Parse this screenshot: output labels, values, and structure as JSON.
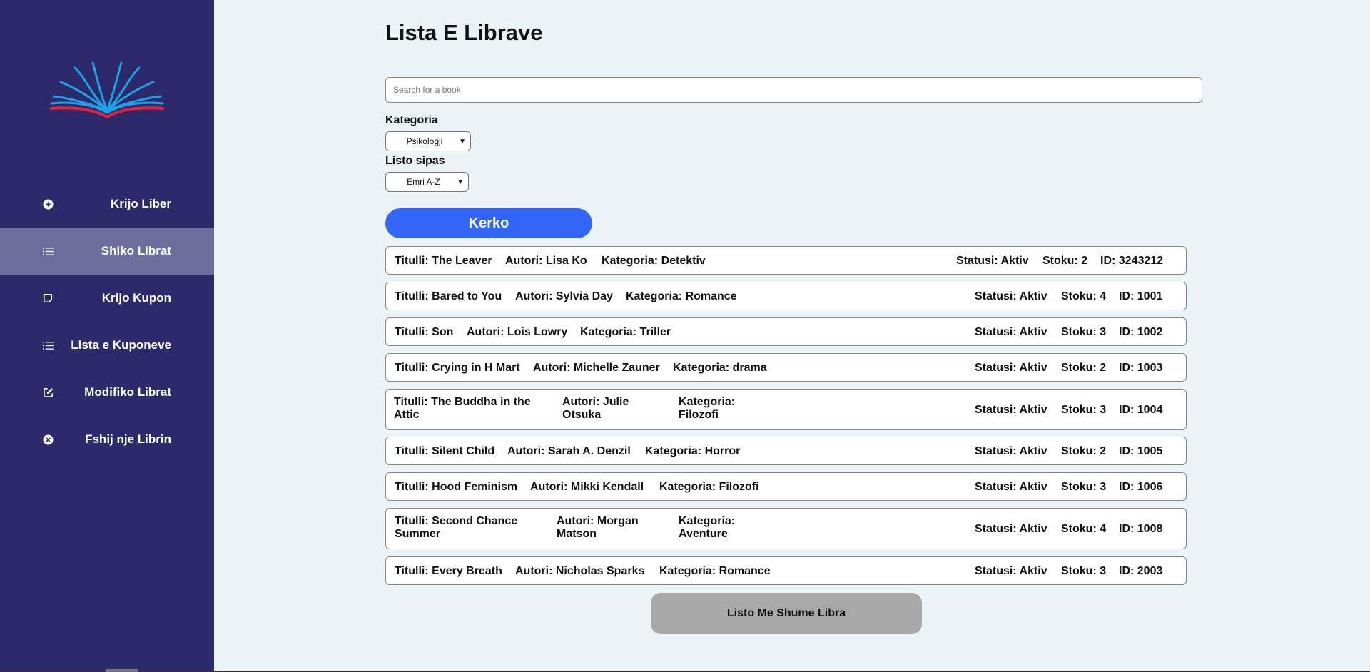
{
  "sidebar": {
    "items": [
      {
        "label": "Krijo Liber",
        "icon": "plus-circle-icon",
        "active": false
      },
      {
        "label": "Shiko Librat",
        "icon": "list-icon",
        "active": true
      },
      {
        "label": "Krijo Kupon",
        "icon": "note-icon",
        "active": false
      },
      {
        "label": "Lista e Kuponeve",
        "icon": "list-icon",
        "active": false
      },
      {
        "label": "Modifiko Librat",
        "icon": "edit-icon",
        "active": false
      },
      {
        "label": "Fshij nje Librin",
        "icon": "close-circle-icon",
        "active": false
      }
    ]
  },
  "main": {
    "title": "Lista E Librave",
    "search_placeholder": "Search for a book",
    "category_label": "Kategoria",
    "category_value": "Psikologji",
    "sort_label": "Listo sipas",
    "sort_value": "Emri A-Z",
    "search_button": "Kerko",
    "more_button": "Listo Me Shume Libra"
  },
  "books": [
    {
      "title": "Titulli: The Leaver",
      "author": "Autori: Lisa Ko",
      "category": "Kategoria: Detektiv",
      "status": "Statusi: Aktiv",
      "stock": "Stoku: 2",
      "id": "ID: 3243212"
    },
    {
      "title": "Titulli: Bared to You",
      "author": "Autori: Sylvia Day",
      "category": "Kategoria: Romance",
      "status": "Statusi: Aktiv",
      "stock": "Stoku: 4",
      "id": "ID: 1001"
    },
    {
      "title": "Titulli: Son",
      "author": "Autori: Lois Lowry",
      "category": "Kategoria: Triller",
      "status": "Statusi: Aktiv",
      "stock": "Stoku: 3",
      "id": "ID: 1002"
    },
    {
      "title": "Titulli: Crying in H Mart",
      "author": "Autori: Michelle Zauner",
      "category": "Kategoria: drama",
      "status": "Statusi: Aktiv",
      "stock": "Stoku: 2",
      "id": "ID: 1003"
    },
    {
      "title": "Titulli: The Buddha in the Attic",
      "author": "Autori: Julie Otsuka",
      "category": "Kategoria: Filozofi",
      "status": "Statusi: Aktiv",
      "stock": "Stoku: 3",
      "id": "ID: 1004"
    },
    {
      "title": "Titulli: Silent Child",
      "author": "Autori: Sarah A. Denzil",
      "category": "Kategoria: Horror",
      "status": "Statusi: Aktiv",
      "stock": "Stoku: 2",
      "id": "ID: 1005"
    },
    {
      "title": "Titulli: Hood Feminism",
      "author": "Autori: Mikki Kendall",
      "category": "Kategoria: Filozofi",
      "status": "Statusi: Aktiv",
      "stock": "Stoku: 3",
      "id": "ID: 1006"
    },
    {
      "title": "Titulli: Second Chance Summer",
      "author": "Autori: Morgan Matson",
      "category": "Kategoria: Aventure",
      "status": "Statusi: Aktiv",
      "stock": "Stoku: 4",
      "id": "ID: 1008"
    },
    {
      "title": "Titulli: Every Breath",
      "author": "Autori: Nicholas Sparks",
      "category": "Kategoria: Romance",
      "status": "Statusi: Aktiv",
      "stock": "Stoku: 3",
      "id": "ID: 2003"
    }
  ],
  "colors": {
    "sidebar_bg": "#2d2a6b",
    "sidebar_active": "#6e6d9b",
    "page_bg": "#ecf3f7",
    "accent": "#3266f8",
    "more_button_bg": "#a9a9a9"
  }
}
